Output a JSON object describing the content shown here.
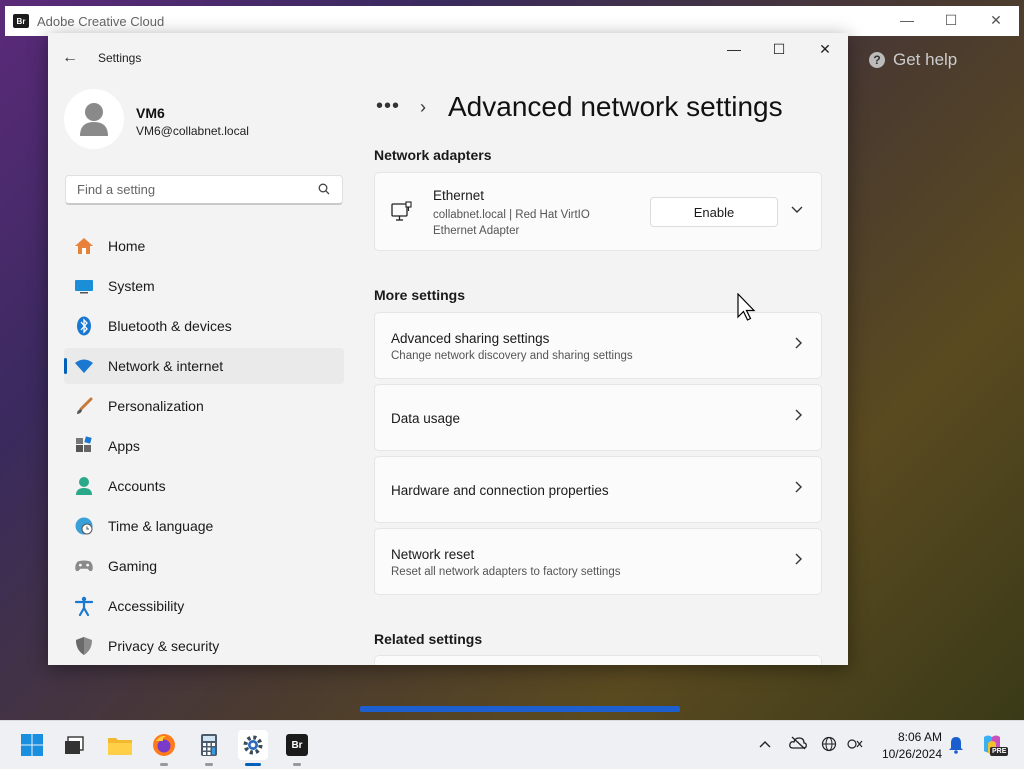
{
  "adobe": {
    "title": "Adobe Creative Cloud",
    "logo_text": "Br",
    "help_label": "Get help"
  },
  "settings": {
    "window_title": "Settings",
    "profile": {
      "name": "VM6",
      "email": "VM6@collabnet.local"
    },
    "search": {
      "placeholder": "Find a setting"
    },
    "nav": [
      {
        "label": "Home",
        "icon": "home-icon"
      },
      {
        "label": "System",
        "icon": "system-icon"
      },
      {
        "label": "Bluetooth & devices",
        "icon": "bluetooth-icon"
      },
      {
        "label": "Network & internet",
        "icon": "wifi-icon",
        "active": true
      },
      {
        "label": "Personalization",
        "icon": "brush-icon"
      },
      {
        "label": "Apps",
        "icon": "apps-icon"
      },
      {
        "label": "Accounts",
        "icon": "accounts-icon"
      },
      {
        "label": "Time & language",
        "icon": "globe-clock-icon"
      },
      {
        "label": "Gaming",
        "icon": "gamepad-icon"
      },
      {
        "label": "Accessibility",
        "icon": "accessibility-icon"
      },
      {
        "label": "Privacy & security",
        "icon": "shield-icon"
      }
    ],
    "breadcrumb_ellipsis": "•••",
    "page_title": "Advanced network settings",
    "sections": {
      "network_adapters": "Network adapters",
      "more_settings": "More settings",
      "related_settings": "Related settings"
    },
    "ethernet": {
      "name": "Ethernet",
      "description_line1": "collabnet.local | Red Hat VirtIO",
      "description_line2": "Ethernet Adapter",
      "button_label": "Enable"
    },
    "more_items": [
      {
        "title": "Advanced sharing settings",
        "subtitle": "Change network discovery and sharing settings"
      },
      {
        "title": "Data usage",
        "subtitle": ""
      },
      {
        "title": "Hardware and connection properties",
        "subtitle": ""
      },
      {
        "title": "Network reset",
        "subtitle": "Reset all network adapters to factory settings"
      }
    ]
  },
  "taskbar": {
    "apps": [
      "start-icon",
      "file-explorer-icon",
      "folder-icon",
      "firefox-icon",
      "calculator-icon",
      "settings-icon",
      "bridge-icon"
    ],
    "time": "8:06 AM",
    "date": "10/26/2024",
    "bridge_label": "Br",
    "copilot_badge": "PRE"
  },
  "colors": {
    "accent": "#005fb8",
    "window_bg": "#f3f3f3",
    "card_bg": "#fbfbfb"
  }
}
